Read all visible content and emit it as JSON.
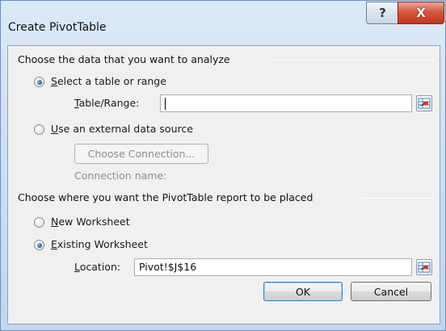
{
  "window": {
    "title": "Create PivotTable",
    "help_glyph": "?",
    "close_glyph": "X"
  },
  "analyze_group": {
    "label": "Choose the data that you want to analyze",
    "select_range": {
      "label_prefix": "",
      "label_accel": "S",
      "label_rest": "elect a table or range",
      "checked": true
    },
    "table_range": {
      "label_accel": "T",
      "label_rest": "able/Range:",
      "value": ""
    },
    "external_source": {
      "label_accel": "U",
      "label_rest": "se an external data source",
      "checked": false
    },
    "choose_connection_label": "Choose Connection...",
    "connection_name_label": "Connection name:"
  },
  "placement_group": {
    "label": "Choose where you want the PivotTable report to be placed",
    "new_worksheet": {
      "label_accel": "N",
      "label_rest": "ew Worksheet",
      "checked": false
    },
    "existing_worksheet": {
      "label_accel": "E",
      "label_rest": "xisting Worksheet",
      "checked": true
    },
    "location": {
      "label_accel": "L",
      "label_rest": "ocation:",
      "value": "Pivot!$J$16"
    }
  },
  "buttons": {
    "ok_label": "OK",
    "cancel_label": "Cancel"
  }
}
